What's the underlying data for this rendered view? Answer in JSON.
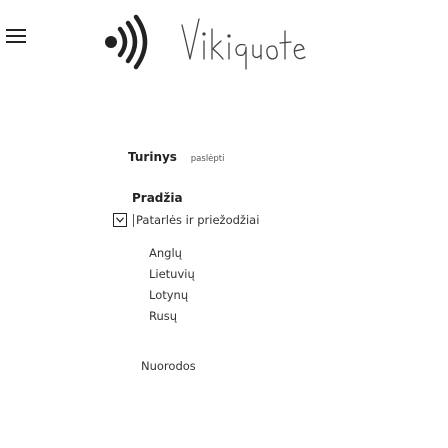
{
  "header": {
    "logo_icon": "radio-waves-logo",
    "menu_icon": "hamburger-menu-icon",
    "logo_text": "Vikiquote"
  },
  "toc": {
    "title": "Turinys",
    "toggle_label": "paslėpti"
  },
  "section": {
    "title": "Pradžia"
  },
  "nav": {
    "expanded_item": {
      "label": "Patarlės ir priežodžiai",
      "toggle_icon": "chevron-down-icon"
    },
    "children": [
      "Anglų",
      "Lietuvių",
      "Lotynų",
      "Rusų"
    ],
    "bottom_item": "Nuorodos"
  },
  "colors": {
    "text": "#333333",
    "logo": "#222222",
    "border": "#222222"
  }
}
